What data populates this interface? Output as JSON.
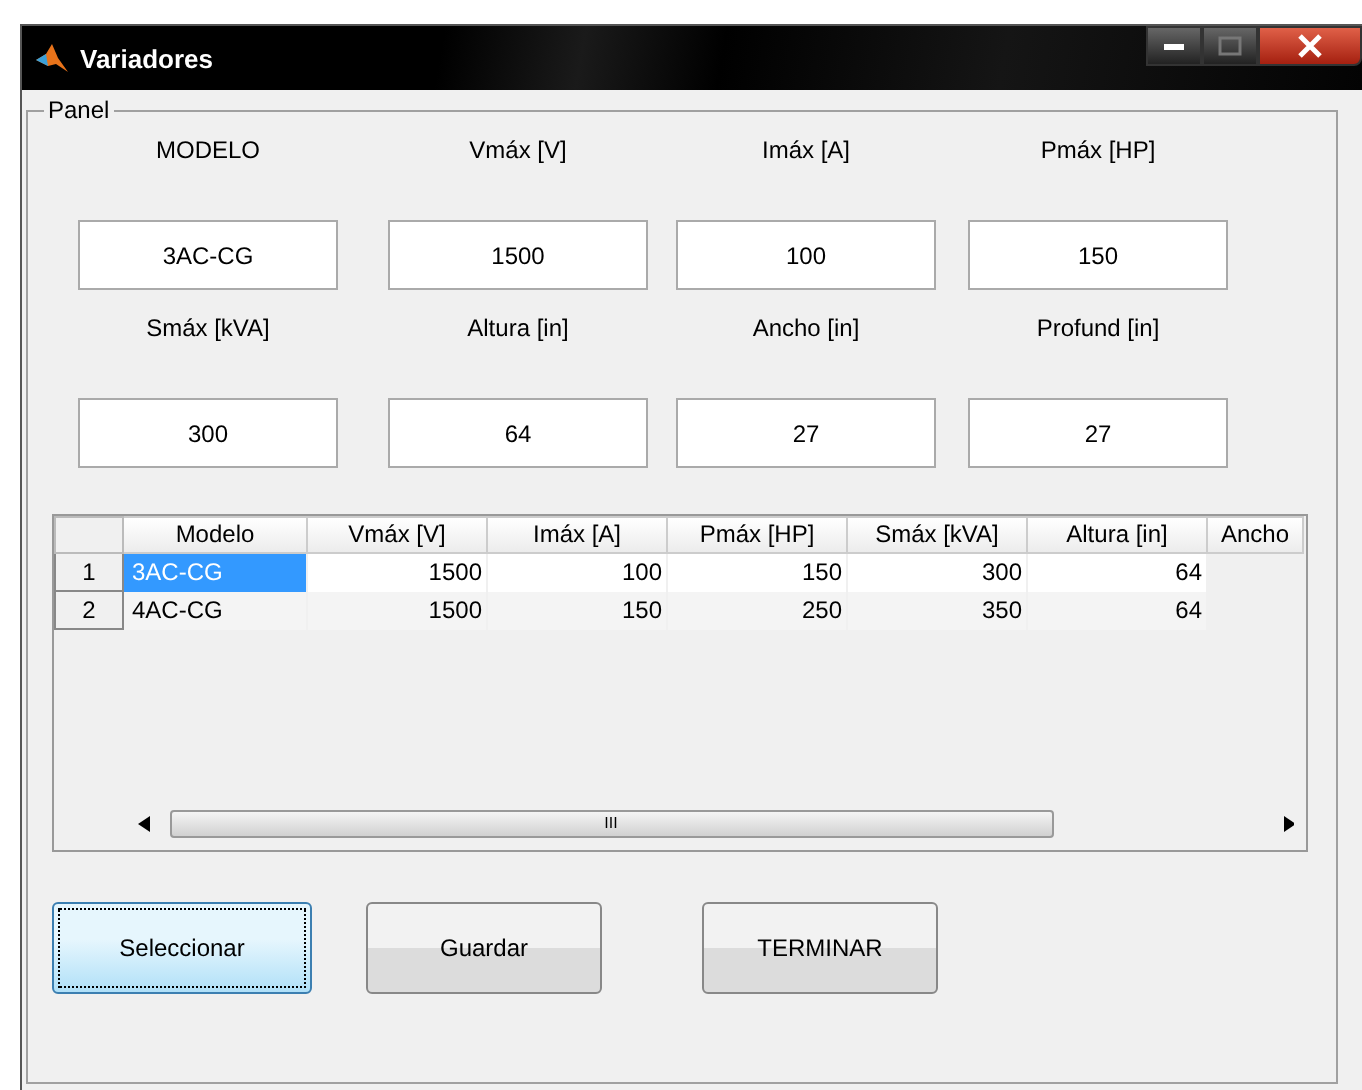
{
  "window": {
    "title": "Variadores"
  },
  "panel": {
    "title": "Panel"
  },
  "fields": [
    {
      "label": "MODELO",
      "value": "3AC-CG"
    },
    {
      "label": "Vmáx [V]",
      "value": "1500"
    },
    {
      "label": "Imáx [A]",
      "value": "100"
    },
    {
      "label": "Pmáx [HP]",
      "value": "150"
    },
    {
      "label": "Smáx [kVA]",
      "value": "300"
    },
    {
      "label": "Altura [in]",
      "value": "64"
    },
    {
      "label": "Ancho [in]",
      "value": "27"
    },
    {
      "label": "Profund [in]",
      "value": "27"
    }
  ],
  "table": {
    "columns": [
      "Modelo",
      "Vmáx [V]",
      "Imáx [A]",
      "Pmáx [HP]",
      "Smáx [kVA]",
      "Altura [in]",
      "Ancho"
    ],
    "rows": [
      {
        "header": "1",
        "cells": [
          {
            "text": "3AC-CG",
            "selected": true
          },
          {
            "text": "1500",
            "selected": false
          },
          {
            "text": "100",
            "selected": false
          },
          {
            "text": "150",
            "selected": false
          },
          {
            "text": "300",
            "selected": false
          },
          {
            "text": "64",
            "selected": false
          }
        ]
      },
      {
        "header": "2",
        "cells": [
          {
            "text": "4AC-CG",
            "selected": false
          },
          {
            "text": "1500",
            "selected": false
          },
          {
            "text": "150",
            "selected": false
          },
          {
            "text": "250",
            "selected": false
          },
          {
            "text": "350",
            "selected": false
          },
          {
            "text": "64",
            "selected": false
          }
        ]
      }
    ],
    "scrollbar_grip": "III"
  },
  "buttons": [
    {
      "label": "Seleccionar",
      "selected": true
    },
    {
      "label": "Guardar",
      "selected": false
    },
    {
      "label": "TERMINAR",
      "selected": false
    }
  ]
}
